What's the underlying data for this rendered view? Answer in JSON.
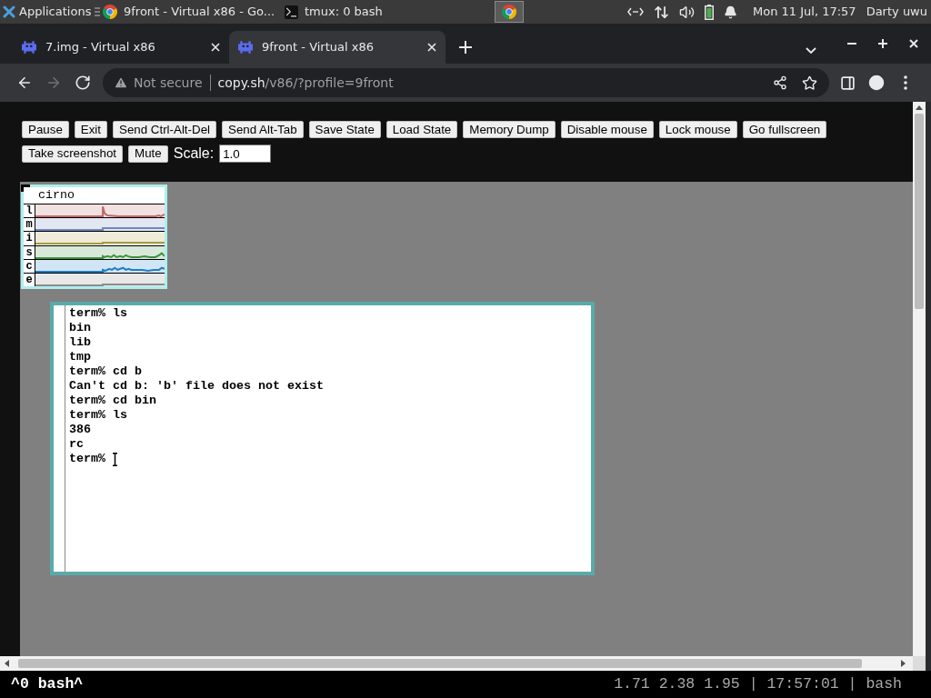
{
  "taskbar": {
    "menu": "Applications",
    "tasks": [
      {
        "title": "9front - Virtual x86 - Go...",
        "kind": "browser"
      },
      {
        "title": "tmux: 0 bash",
        "kind": "terminal"
      }
    ],
    "clock": "Mon 11 Jul, 17:57",
    "user": "Darty uwu"
  },
  "browser": {
    "tabs": [
      {
        "title": "7.img - Virtual x86",
        "selected": false
      },
      {
        "title": "9front - Virtual x86",
        "selected": true
      }
    ],
    "navigation": [
      {
        "kind": "back",
        "disabled": false
      },
      {
        "kind": "forward",
        "disabled": true
      },
      {
        "kind": "reload",
        "disabled": false
      }
    ],
    "address": {
      "security": "Not secure",
      "host": "copy.sh",
      "path": "/v86/?profile=9front"
    }
  },
  "page": {
    "control_rows": [
      [
        {
          "kind": "button",
          "label": "Pause"
        },
        {
          "kind": "button",
          "label": "Exit"
        },
        {
          "kind": "button",
          "label": "Send Ctrl-Alt-Del"
        },
        {
          "kind": "button",
          "label": "Send Alt-Tab"
        },
        {
          "kind": "button",
          "label": "Save State"
        },
        {
          "kind": "button",
          "label": "Load State"
        },
        {
          "kind": "button",
          "label": "Memory Dump"
        },
        {
          "kind": "button",
          "label": "Disable mouse"
        },
        {
          "kind": "button",
          "label": "Lock mouse"
        },
        {
          "kind": "button",
          "label": "Go fullscreen"
        }
      ],
      [
        {
          "kind": "button",
          "label": "Take screenshot"
        },
        {
          "kind": "button",
          "label": "Mute"
        },
        {
          "kind": "label",
          "text": "Scale:"
        },
        {
          "kind": "input",
          "value": "1.0"
        }
      ]
    ]
  },
  "vm_screen": {
    "stats": {
      "host": "cirno",
      "meters": [
        {
          "label": "l",
          "color": "#c06a6a"
        },
        {
          "label": "m",
          "color": "#7088c0"
        },
        {
          "label": "i",
          "color": "#a89a40"
        },
        {
          "label": "s",
          "color": "#3f8f3f"
        },
        {
          "label": "c",
          "color": "#1f7fc8"
        },
        {
          "label": "e",
          "color": "#8c8c8c"
        }
      ]
    },
    "terminal": {
      "lines": [
        "term% ls",
        "bin",
        "lib",
        "tmp",
        "term% cd b",
        "Can't cd b: 'b' file does not exist",
        "term% cd bin",
        "term% ls",
        "386",
        "rc",
        "term%"
      ]
    }
  },
  "status_bar": {
    "left": "^0 bash^",
    "right": "1.71 2.38 1.95 | 17:57:01 | bash"
  }
}
